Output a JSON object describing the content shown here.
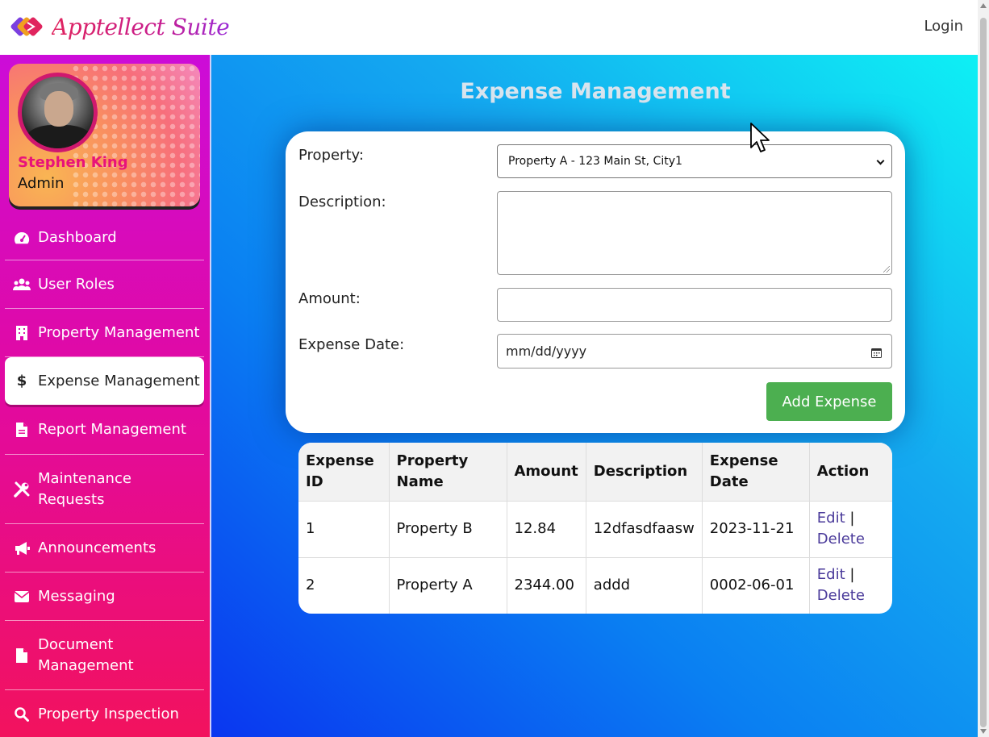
{
  "app": {
    "brand": "Apptellect Suite",
    "login_label": "Login"
  },
  "profile": {
    "name": "Stephen King",
    "role": "Admin"
  },
  "sidebar": {
    "items": [
      {
        "label": "Dashboard",
        "icon": "dashboard-icon"
      },
      {
        "label": "User Roles",
        "icon": "users-icon"
      },
      {
        "label": "Property Management",
        "icon": "building-icon"
      },
      {
        "label": "Expense Management",
        "icon": "dollar-icon",
        "active": true
      },
      {
        "label": "Report Management",
        "icon": "file-icon"
      },
      {
        "label": "Maintenance Requests",
        "icon": "tools-icon"
      },
      {
        "label": "Announcements",
        "icon": "megaphone-icon"
      },
      {
        "label": "Messaging",
        "icon": "envelope-icon"
      },
      {
        "label": "Document Management",
        "icon": "file-icon"
      },
      {
        "label": "Property Inspection",
        "icon": "search-icon"
      }
    ]
  },
  "main": {
    "title": "Expense Management",
    "form": {
      "property_label": "Property:",
      "property_value": "Property A - 123 Main St, City1",
      "description_label": "Description:",
      "description_value": "",
      "amount_label": "Amount:",
      "amount_value": "",
      "date_label": "Expense Date:",
      "date_placeholder": "mm/dd/yyyy",
      "submit_label": "Add Expense"
    },
    "table": {
      "headers": [
        "Expense ID",
        "Property Name",
        "Amount",
        "Description",
        "Expense Date",
        "Action"
      ],
      "rows": [
        {
          "id": "1",
          "property": "Property B",
          "amount": "12.84",
          "description": "12dfasdfaasw",
          "date": "2023-11-21"
        },
        {
          "id": "2",
          "property": "Property A",
          "amount": "2344.00",
          "description": "addd",
          "date": "0002-06-01"
        }
      ],
      "edit_label": "Edit",
      "separator": "|",
      "delete_label": "Delete"
    }
  },
  "colors": {
    "accent_green": "#4caf50",
    "brand_pink": "#e8127a",
    "link": "#4a3a9a"
  }
}
